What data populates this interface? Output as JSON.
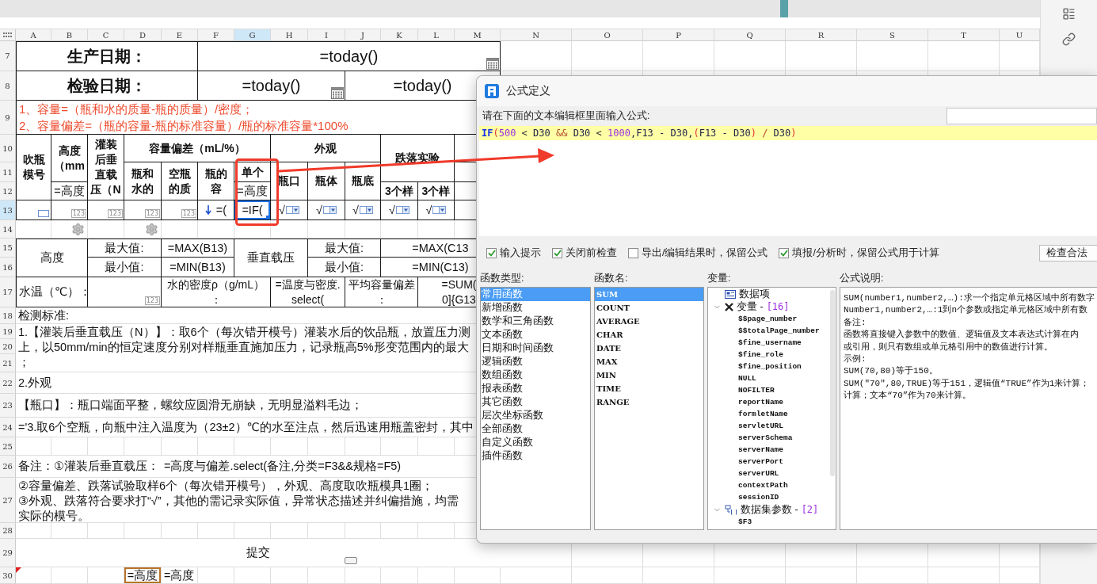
{
  "sheet": {
    "columns": [
      {
        "label": "A",
        "selected": false
      },
      {
        "label": "B",
        "selected": false
      },
      {
        "label": "C",
        "selected": false
      },
      {
        "label": "D",
        "selected": false
      },
      {
        "label": "E",
        "selected": false
      },
      {
        "label": "F",
        "selected": false
      },
      {
        "label": "G",
        "selected": true
      },
      {
        "label": "H",
        "selected": false
      },
      {
        "label": "I",
        "selected": false
      },
      {
        "label": "J",
        "selected": false
      },
      {
        "label": "K",
        "selected": false
      },
      {
        "label": "L",
        "selected": false
      },
      {
        "label": "M",
        "selected": false
      },
      {
        "label": "N",
        "selected": false
      },
      {
        "label": "O",
        "selected": false
      },
      {
        "label": "P",
        "selected": false
      },
      {
        "label": "Q",
        "selected": false
      },
      {
        "label": "R",
        "selected": false
      },
      {
        "label": "S",
        "selected": false
      },
      {
        "label": "T",
        "selected": false
      },
      {
        "label": "U",
        "selected": false
      }
    ],
    "rows": [
      {
        "label": "7",
        "selected": false
      },
      {
        "label": "8",
        "selected": false
      },
      {
        "label": "9",
        "selected": false
      },
      {
        "label": "10",
        "selected": false
      },
      {
        "label": "11",
        "selected": false
      },
      {
        "label": "12",
        "selected": false
      },
      {
        "label": "13",
        "selected": true
      },
      {
        "label": "14",
        "selected": false
      },
      {
        "label": "15",
        "selected": false
      },
      {
        "label": "16",
        "selected": false
      },
      {
        "label": "17",
        "selected": false
      },
      {
        "label": "18",
        "selected": false
      },
      {
        "label": "19",
        "selected": false
      },
      {
        "label": "20",
        "selected": false
      },
      {
        "label": "21",
        "selected": false
      },
      {
        "label": "22",
        "selected": false
      },
      {
        "label": "23",
        "selected": false
      },
      {
        "label": "24",
        "selected": false
      },
      {
        "label": "25",
        "selected": false
      },
      {
        "label": "26",
        "selected": false
      },
      {
        "label": "27",
        "selected": false
      },
      {
        "label": "28",
        "selected": false
      },
      {
        "label": "29",
        "selected": false
      },
      {
        "label": "30",
        "selected": false
      }
    ],
    "cells": [
      {
        "kind": "text",
        "text": "生产日期：",
        "selected": false
      },
      {
        "kind": "date",
        "text": "=today()",
        "selected": false
      },
      {
        "kind": "text",
        "text": "检验日期：",
        "selected": false
      },
      {
        "kind": "date",
        "text": "=today()",
        "selected": false
      },
      {
        "kind": "text",
        "text": "=today()",
        "selected": false
      },
      {
        "kind": "text",
        "text": "1、容量=（瓶和水的质量-瓶的质量）/密度；\n2、容量偏差=（瓶的容量-瓶的标准容量）/瓶的标准容量*100%",
        "selected": false
      },
      {
        "kind": "text",
        "text": "吹瓶模号",
        "selected": false
      },
      {
        "kind": "text",
        "text": "高度（mm",
        "selected": false
      },
      {
        "kind": "text",
        "text": "灌装后垂直载压（N",
        "selected": false
      },
      {
        "kind": "text",
        "text": "容量偏差（mL/%）",
        "selected": false
      },
      {
        "kind": "text",
        "text": "外观",
        "selected": false
      },
      {
        "kind": "text",
        "text": "跌落实验",
        "selected": false
      },
      {
        "kind": "text",
        "text": "瓶和水的",
        "selected": false
      },
      {
        "kind": "text",
        "text": "空瓶的质",
        "selected": false
      },
      {
        "kind": "text",
        "text": "瓶的容",
        "selected": false
      },
      {
        "kind": "text",
        "text": "单个",
        "selected": false
      },
      {
        "kind": "text",
        "text": "瓶口",
        "selected": false
      },
      {
        "kind": "text",
        "text": "瓶体",
        "selected": false
      },
      {
        "kind": "text",
        "text": "瓶底",
        "selected": false
      },
      {
        "kind": "text",
        "text": "=高度",
        "selected": false
      },
      {
        "kind": "text",
        "text": "=高度",
        "selected": false
      },
      {
        "kind": "text",
        "text": "3个样",
        "selected": false
      },
      {
        "kind": "text",
        "text": "3个样",
        "selected": false
      },
      {
        "kind": "field",
        "selected": false
      },
      {
        "kind": "number",
        "badge": "123",
        "selected": false
      },
      {
        "kind": "number",
        "badge": "123",
        "selected": false
      },
      {
        "kind": "number",
        "badge": "123",
        "selected": false
      },
      {
        "kind": "number",
        "badge": "123",
        "selected": false
      },
      {
        "kind": "expand",
        "text": "=(",
        "selected": false
      },
      {
        "kind": "text",
        "text": "=IF(",
        "selected": true
      },
      {
        "kind": "dropdown",
        "text": "√",
        "selected": false
      },
      {
        "kind": "dropdown",
        "text": "√",
        "selected": false
      },
      {
        "kind": "dropdown",
        "text": "√",
        "selected": false
      },
      {
        "kind": "dropdown",
        "text": "√",
        "selected": false
      },
      {
        "kind": "dropdown",
        "text": "√",
        "selected": false
      },
      {
        "kind": "gear",
        "selected": false
      },
      {
        "kind": "gear",
        "selected": false
      },
      {
        "kind": "text",
        "text": "高度",
        "selected": false
      },
      {
        "kind": "text",
        "text": "最大值:",
        "selected": false
      },
      {
        "kind": "text",
        "text": "=MAX(B13)",
        "selected": false
      },
      {
        "kind": "text",
        "text": "垂直载压",
        "selected": false
      },
      {
        "kind": "text",
        "text": "最大值:",
        "selected": false
      },
      {
        "kind": "text",
        "text": "=MAX(C13",
        "selected": false
      },
      {
        "kind": "text",
        "text": "最小值:",
        "selected": false
      },
      {
        "kind": "text",
        "text": "=MIN(B13)",
        "selected": false
      },
      {
        "kind": "text",
        "text": "最小值:",
        "selected": false
      },
      {
        "kind": "text",
        "text": "=MIN(C13)",
        "selected": false
      },
      {
        "kind": "text",
        "text": "水温（℃）：",
        "selected": false
      },
      {
        "kind": "number",
        "badge": "123",
        "selected": false
      },
      {
        "kind": "text",
        "lines": [
          "水的密度ρ（g/mL）",
          "："
        ],
        "selected": false
      },
      {
        "kind": "text",
        "text": "=温度与密度.\nselect(",
        "selected": false
      },
      {
        "kind": "text",
        "lines": [
          "平均容量偏差",
          "："
        ],
        "selected": false
      },
      {
        "kind": "text",
        "text": "=SUM(\n0]{G13",
        "selected": false
      },
      {
        "kind": "text",
        "text": "检测标准:",
        "selected": false
      },
      {
        "kind": "text",
        "lines": [
          "1.【灌装后垂直载压（N）】：取6个（每次错开模号）灌装水后的饮品瓶，放置压力测",
          "上，以50mm/min的恒定速度分别对样瓶垂直施加压力，记录瓶高5%形变范围内的最大",
          "；"
        ],
        "selected": false
      },
      {
        "kind": "text",
        "text": "2.外观",
        "selected": false
      },
      {
        "kind": "text",
        "text": "【瓶口】：瓶口端面平整，螺纹应圆滑无崩缺，无明显溢料毛边；",
        "selected": false
      },
      {
        "kind": "text",
        "text": "='3.取6个空瓶，向瓶中注入温度为（23±2）℃的水至注点，然后迅速用瓶盖密封，其中",
        "selected": false
      },
      {
        "kind": "text",
        "text": "备注：①灌装后垂直载压：",
        "selected": false
      },
      {
        "kind": "text",
        "text": "=高度与偏差.select(备注,分类=F3&&规格=F5)",
        "selected": false
      },
      {
        "kind": "text",
        "lines": [
          "②容量偏差、跌落试验取样6个（每次错开模号），外观、高度取吹瓶模具1圈；",
          "③外观、跌落符合要求打“√”，其他的需记录实际值，异常状态描述并纠偏措施，均需",
          "实际的模号。"
        ],
        "selected": false
      },
      {
        "kind": "submit",
        "text": "提交",
        "selected": false
      },
      {
        "kind": "ref",
        "text": "=高度",
        "selected": false
      },
      {
        "kind": "text",
        "text": "=高度",
        "selected": false
      },
      {
        "kind": "comment",
        "selected": false
      }
    ]
  },
  "dialog": {
    "title": "公式定义",
    "prompt": "请在下面的文本编辑框里面输入公式:",
    "formula": [
      {
        "kind": "function",
        "text": "IF"
      },
      {
        "kind": "bracket",
        "text": "("
      },
      {
        "kind": "number",
        "text": "500"
      },
      {
        "kind": "operator",
        "text": " < "
      },
      {
        "kind": "ref",
        "text": "D30"
      },
      {
        "kind": "logic",
        "text": " && "
      },
      {
        "kind": "ref",
        "text": "D30"
      },
      {
        "kind": "operator",
        "text": " < "
      },
      {
        "kind": "number",
        "text": "1000"
      },
      {
        "kind": "ref",
        "text": ",F13 - D30,"
      },
      {
        "kind": "bracket",
        "text": "("
      },
      {
        "kind": "ref",
        "text": "F13 - D30"
      },
      {
        "kind": "bracket",
        "text": ")"
      },
      {
        "kind": "logic",
        "text": " / "
      },
      {
        "kind": "ref",
        "text": "D30"
      },
      {
        "kind": "bracket",
        "text": ")"
      }
    ],
    "options": [
      {
        "label": "输入提示",
        "checked": true
      },
      {
        "label": "关闭前检查",
        "checked": true
      },
      {
        "label": "导出/编辑结果时，保留公式",
        "checked": false
      },
      {
        "label": "填报/分析时，保留公式用于计算",
        "checked": true
      }
    ],
    "check_button": "检查合法",
    "function_types": {
      "label": "函数类型:",
      "items": [
        {
          "label": "常用函数",
          "selected": true
        },
        {
          "label": "新增函数",
          "selected": false
        },
        {
          "label": "数学和三角函数",
          "selected": false
        },
        {
          "label": "文本函数",
          "selected": false
        },
        {
          "label": "日期和时间函数",
          "selected": false
        },
        {
          "label": "逻辑函数",
          "selected": false
        },
        {
          "label": "数组函数",
          "selected": false
        },
        {
          "label": "报表函数",
          "selected": false
        },
        {
          "label": "其它函数",
          "selected": false
        },
        {
          "label": "层次坐标函数",
          "selected": false
        },
        {
          "label": "全部函数",
          "selected": false
        },
        {
          "label": "自定义函数",
          "selected": false
        },
        {
          "label": "插件函数",
          "selected": false
        }
      ]
    },
    "function_names": {
      "label": "函数名:",
      "items": [
        {
          "label": "SUM",
          "selected": true
        },
        {
          "label": "COUNT",
          "selected": false
        },
        {
          "label": "AVERAGE",
          "selected": false
        },
        {
          "label": "CHAR",
          "selected": false
        },
        {
          "label": "DATE",
          "selected": false
        },
        {
          "label": "MAX",
          "selected": false
        },
        {
          "label": "MIN",
          "selected": false
        },
        {
          "label": "TIME",
          "selected": false
        },
        {
          "label": "RANGE",
          "selected": false
        }
      ]
    },
    "variables": {
      "label": "变量:",
      "tree": [
        {
          "kind": "data",
          "label": "数据项",
          "selected": false
        },
        {
          "kind": "variables",
          "label": "变量 -",
          "count": "[16]",
          "expanded": true,
          "selected": false,
          "children": [
            {
              "label": "$$page_number",
              "selected": false
            },
            {
              "label": "$$totalPage_number",
              "selected": false
            },
            {
              "label": "$fine_username",
              "selected": false
            },
            {
              "label": "$fine_role",
              "selected": false
            },
            {
              "label": "$fine_position",
              "selected": false
            },
            {
              "label": "NULL",
              "selected": false
            },
            {
              "label": "NOFILTER",
              "selected": false
            },
            {
              "label": "reportName",
              "selected": false
            },
            {
              "label": "formletName",
              "selected": false
            },
            {
              "label": "servletURL",
              "selected": false
            },
            {
              "label": "serverSchema",
              "selected": false
            },
            {
              "label": "serverName",
              "selected": false
            },
            {
              "label": "serverPort",
              "selected": false
            },
            {
              "label": "serverURL",
              "selected": false
            },
            {
              "label": "contextPath",
              "selected": false
            },
            {
              "label": "sessionID",
              "selected": false
            }
          ]
        },
        {
          "kind": "parameters",
          "label": "数据集参数 -",
          "count": "[2]",
          "expanded": true,
          "selected": false,
          "children": [
            {
              "label": "$F3",
              "selected": false
            }
          ]
        }
      ]
    },
    "description": {
      "label": "公式说明:",
      "lines": [
        "SUM(number1,number2,…):求一个指定单元格区域中所有数字",
        "Number1,number2,…:1到n个参数或指定单元格区域中所有数",
        "备注:",
        "函数将直接键入参数中的数值、逻辑值及文本表达式计算在内",
        "或引用，则只有数组或单元格引用中的数值进行计算。",
        "示例:",
        "SUM(70,80)等于150。",
        "SUM(\"70\",80,TRUE)等于151，逻辑值“TRUE”作为1来计算；",
        "计算；文本“70”作为70来计算。"
      ]
    }
  }
}
